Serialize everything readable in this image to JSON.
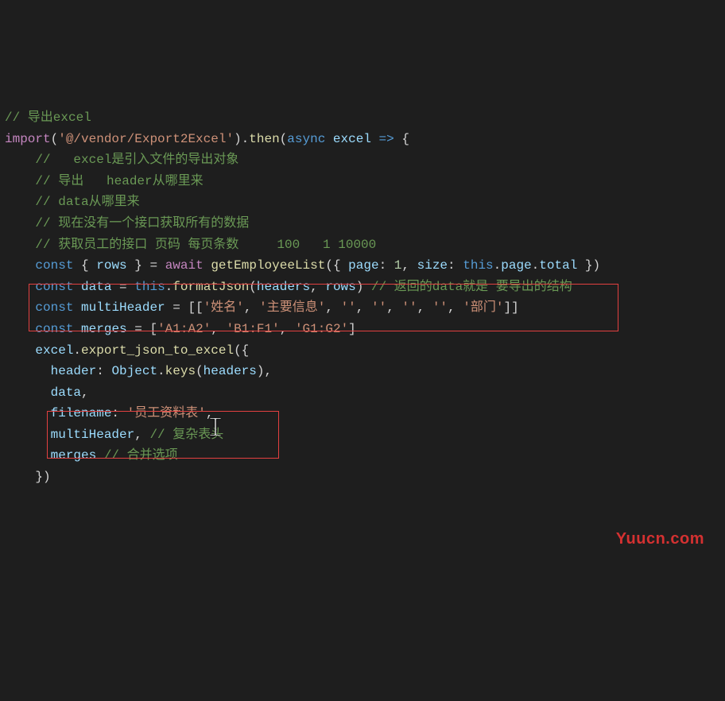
{
  "c0": "// 导出excel",
  "l1_import": "import",
  "l1_s1": "'@/vendor/Export2Excel'",
  "l1_then": "then",
  "l1_async": "async",
  "l1_excel": "excel",
  "c1": "//   excel是引入文件的导出对象",
  "c2": "// 导出   header从哪里来",
  "c3": "// data从哪里来",
  "c4": "// 现在没有一个接口获取所有的数据",
  "c5": "// 获取员工的接口 页码 每页条数     100   1 10000",
  "l6_const": "const",
  "l6_rows": "rows",
  "l6_await": "await",
  "l6_fn": "getEmployeeList",
  "l6_page": "page",
  "l6_n1": "1",
  "l6_size": "size",
  "l6_this": "this",
  "l6_pageprop": "page",
  "l6_total": "total",
  "l7_const": "const",
  "l7_data": "data",
  "l7_this": "this",
  "l7_fn": "formatJson",
  "l7_headers": "headers",
  "l7_rows": "rows",
  "l7_comment": "// 返回的data就是 要导出的结构",
  "l8_const": "const",
  "l8_var": "multiHeader",
  "l8_s1": "'姓名'",
  "l8_s2": "'主要信息'",
  "l8_s3": "''",
  "l8_s4": "''",
  "l8_s5": "''",
  "l8_s6": "''",
  "l8_s7": "'部门'",
  "l9_const": "const",
  "l9_var": "merges",
  "l9_s1": "'A1:A2'",
  "l9_s2": "'B1:F1'",
  "l9_s3": "'G1:G2'",
  "l10_excel": "excel",
  "l10_fn": "export_json_to_excel",
  "l11_header": "header",
  "l11_obj": "Object",
  "l11_keys": "keys",
  "l11_headers": "headers",
  "l12_data": "data",
  "l13_filename": "filename",
  "l13_s": "'员工资料表'",
  "l14_var": "multiHeader",
  "l14_comment": "// 复杂表头",
  "l15_var": "merges",
  "l15_comment": "// 合并选项",
  "watermark": "Yuucn.com"
}
